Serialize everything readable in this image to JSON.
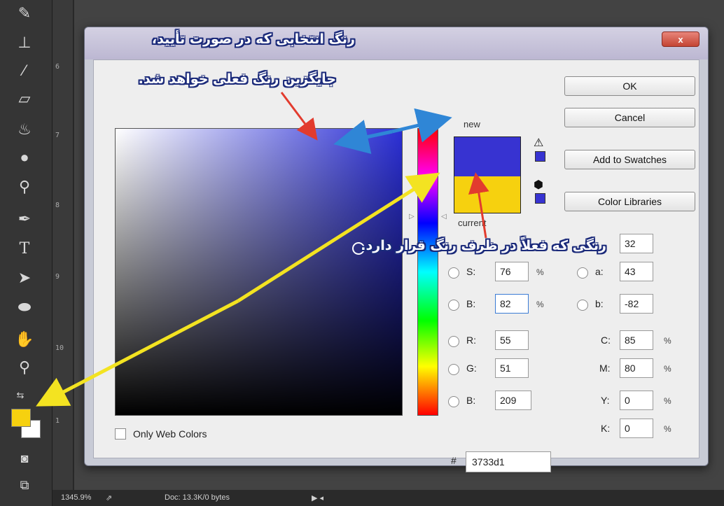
{
  "status": {
    "zoom": "1345.9%",
    "doc": "Doc: 13.3K/0 bytes"
  },
  "ruler": {
    "marks": [
      "6",
      "7",
      "8",
      "9",
      "10",
      "1"
    ]
  },
  "dialog": {
    "close_label": "x",
    "new_label": "new",
    "current_label": "current",
    "new_color": "#3733d1",
    "current_color": "#f6d10f",
    "buttons": {
      "ok": "OK",
      "cancel": "Cancel",
      "add_to_swatches": "Add to Swatches",
      "color_libraries": "Color Libraries"
    },
    "only_web_colors": "Only Web Colors",
    "hsb": {
      "h_value": "32",
      "s_label": "S:",
      "s_value": "76",
      "b_label": "B:",
      "b_value": "82"
    },
    "rgb": {
      "r_label": "R:",
      "r_value": "55",
      "g_label": "G:",
      "g_value": "51",
      "b_label": "B:",
      "b_value": "209"
    },
    "lab": {
      "a_label": "a:",
      "a_value": "43",
      "b_label": "b:",
      "b_value": "-82"
    },
    "cmyk": {
      "c_label": "C:",
      "c_value": "85",
      "m_label": "M:",
      "m_value": "80",
      "y_label": "Y:",
      "y_value": "0",
      "k_label": "K:",
      "k_value": "0"
    },
    "percent": "%",
    "hash": "#",
    "hex_value": "3733d1"
  },
  "annotations": {
    "line1": "رنگ انتخابی که در صورت تأیید،",
    "line2": "جایگزین رنگ فعلی خواهد شد.",
    "line3": "رنگی که فعلاً در ظرف رنگ قرار دارد."
  },
  "colors": {
    "foreground": "#f6d10f",
    "background": "#ffffff",
    "arrow_blue": "#2f86d6",
    "arrow_red": "#e23b2e",
    "arrow_yellow": "#f3e321"
  }
}
